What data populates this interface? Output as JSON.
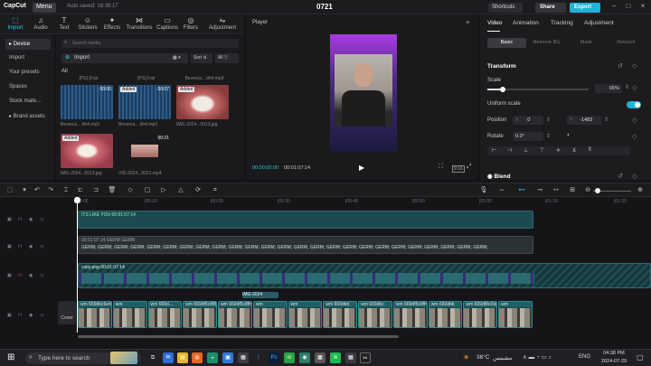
{
  "titlebar": {
    "logo": "CapCut",
    "menu": "Menu",
    "autosave": "Auto saved: 16:38:17",
    "project": "0721",
    "shortcuts": "Shortcuts",
    "share": "Share",
    "export": "Export"
  },
  "tools": [
    {
      "label": "Import",
      "icon": "import-icon"
    },
    {
      "label": "Audio",
      "icon": "audio-icon"
    },
    {
      "label": "Text",
      "icon": "text-icon"
    },
    {
      "label": "Stickers",
      "icon": "stickers-icon"
    },
    {
      "label": "Effects",
      "icon": "effects-icon"
    },
    {
      "label": "Transitions",
      "icon": "transitions-icon"
    },
    {
      "label": "Captions",
      "icon": "captions-icon"
    },
    {
      "label": "Filters",
      "icon": "filters-icon"
    },
    {
      "label": "Adjustment",
      "icon": "adjustment-icon"
    }
  ],
  "leftnav": [
    "Device",
    "Import",
    "Your presets",
    "Spaces",
    "Stock mate...",
    "Brand assets"
  ],
  "media": {
    "search_placeholder": "Search media",
    "import": "Import",
    "sort": "Sort",
    "all": "All",
    "all_label": "All",
    "items": [
      {
        "caption": "Beverca....ith4.mp3",
        "duration": "00:06",
        "added": false,
        "top": "[PS] (Fair"
      },
      {
        "caption": "Beverca....ith4.mp3",
        "duration": "00:07",
        "added": true,
        "top": "[PS] Fair"
      },
      {
        "caption": "IMG-2024...0013.jpg",
        "duration": "",
        "added": true,
        "top": "Beverca....ith4.mp3"
      },
      {
        "caption": "IMG-2024...0013.jpg",
        "duration": "",
        "added": true,
        "top": ""
      },
      {
        "caption": "VID-2024...0021.mp4",
        "duration": "00:21",
        "added": false,
        "top": ""
      }
    ]
  },
  "player": {
    "title": "Player",
    "current": "00:00:00:00",
    "total": "00:01:07:14",
    "ratio": "9:16"
  },
  "props": {
    "tabs": [
      "Video",
      "Animation",
      "Tracking",
      "Adjustment"
    ],
    "subtabs": [
      "Basic",
      "Remove BG",
      "Mask",
      "Retouch"
    ],
    "transform": "Transform",
    "scale": "Scale",
    "scale_value": "65%",
    "uniform": "Uniform scale",
    "position": "Position",
    "pos_x_label": "X",
    "pos_x": "0",
    "pos_y_label": "Y",
    "pos_y": "-1483",
    "rotate": "Rotate",
    "rotate_value": "0.0°",
    "blend": "Blend",
    "scale_fraction": 0.15
  },
  "ruler": [
    "00:00",
    "|00:10",
    "|00:20",
    "|00:30",
    "|00:40",
    "|00:50",
    "|01:00",
    "|01:10",
    "|01:20"
  ],
  "tracks": {
    "clip1": "ITS LIKE YOU 00:01:07:14",
    "clip2": "00:01:07:14 GERM GERM",
    "germ_text": "GERM; GERM; GERM; GERM; GERM; GERM; GERM; GERM; GERM; GERM; GERM; GERM; GERM; GERM; GERM; GERM; GERM; GERM; GERM; GERM; GERM; GERM; GERM; GERM; GERM;",
    "clip3": "copy.png 00:01:07:14",
    "label_img": "IMG-2024",
    "cover": "Cover",
    "video_clips": [
      "wm 669dbc6e4726",
      "wm",
      "wm 669d...",
      "wm 669df5c8f8c4",
      "wm 669df5c8ff4c",
      "wm",
      "wm",
      "wm 669dbd",
      "wm 669dbc",
      "wm 669df5c8ff4a82",
      "wm 669dbb",
      "wm 669df8c0da9d",
      "wm"
    ]
  },
  "taskbar": {
    "search": "Type here to search",
    "weather": "36°C",
    "weather_text": "مشمس",
    "time": "04:38 PM",
    "date": "2024-07-29",
    "lang": "ENG"
  }
}
